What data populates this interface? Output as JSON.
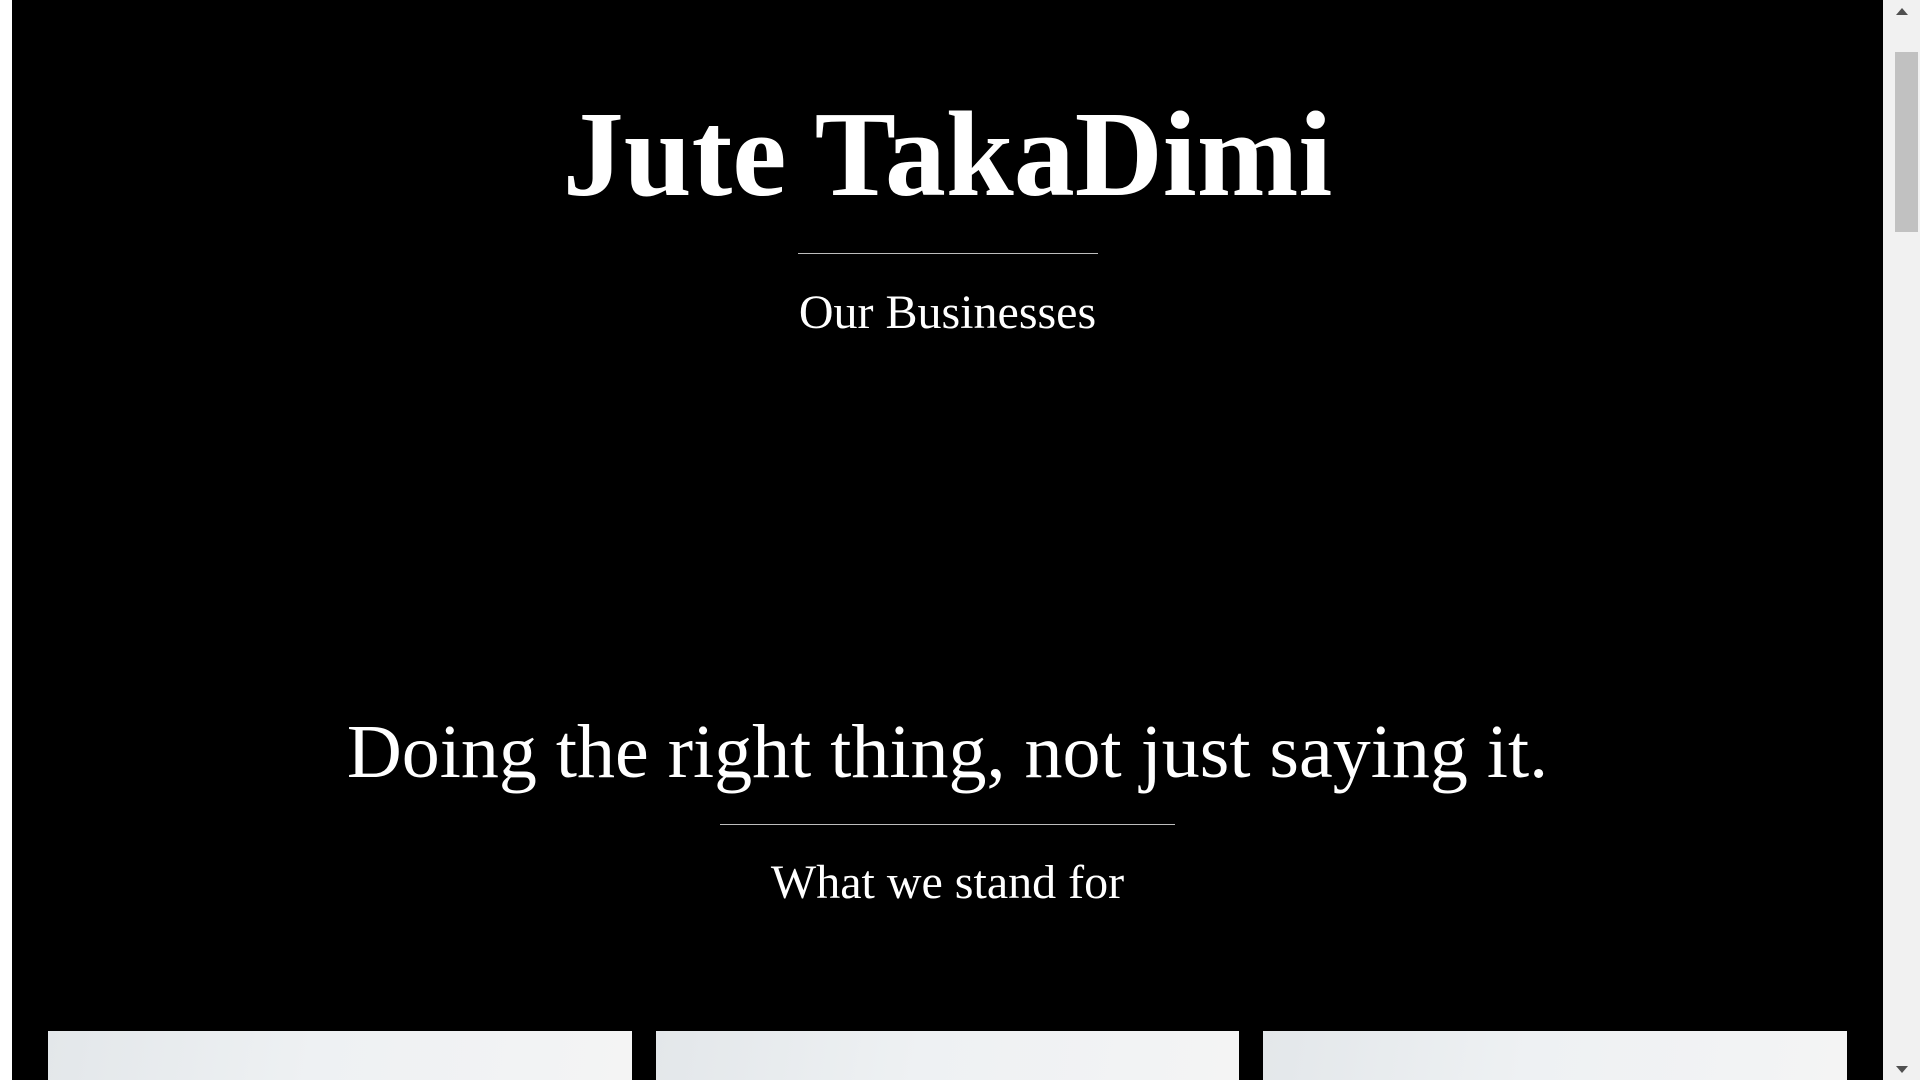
{
  "header": {
    "brand_title": "Jute TakaDimi",
    "section_title": "Our Businesses"
  },
  "mission": {
    "heading": "Doing the right thing, not just saying it.",
    "subtitle": "What we stand for"
  },
  "cards": [
    {
      "name": "value-card-1"
    },
    {
      "name": "value-card-2"
    },
    {
      "name": "value-card-3"
    }
  ],
  "colors": {
    "page_background": "#000000",
    "text": "#ffffff",
    "divider": "#bdbdbd",
    "card_background": "#eef1f3"
  },
  "scrollbar": {
    "up_icon": "chevron-up-icon",
    "down_icon": "chevron-down-icon"
  }
}
